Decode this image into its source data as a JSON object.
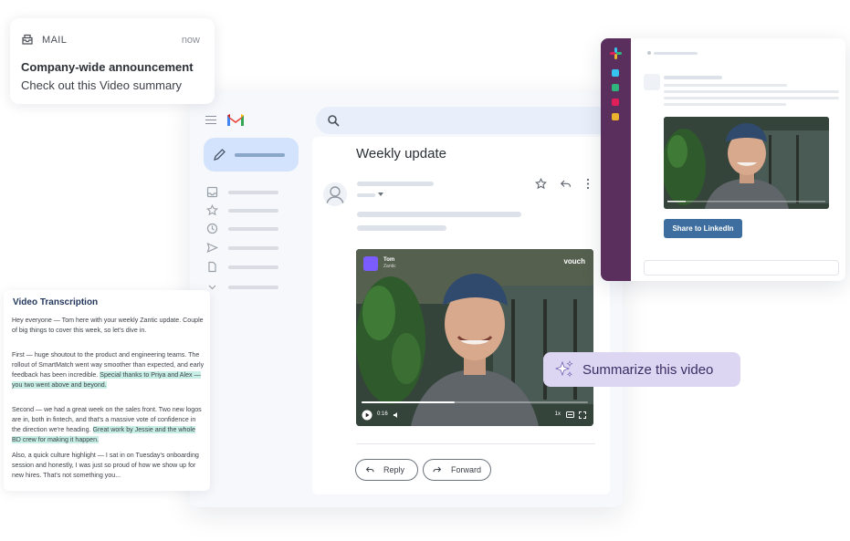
{
  "notification": {
    "app": "MAIL",
    "time": "now",
    "title": "Company-wide announcement",
    "body": "Check out this Video summary"
  },
  "gmail": {
    "subject": "Weekly update",
    "video": {
      "sender_name": "Tom",
      "sender_company": "Zantic",
      "brand": "vouch",
      "time": "0:16",
      "speed": "1x",
      "progress": 0.41
    },
    "reply_label": "Reply",
    "forward_label": "Forward"
  },
  "transcription": {
    "title": "Video Transcription",
    "p1": "Hey everyone — Tom here with your weekly Zantic update. Couple of big things to cover this week, so let's dive in.",
    "p2_plain": "First — huge shoutout to the product and engineering teams. The rollout of SmartMatch went way smoother than expected, and early feedback has been incredible.",
    "p2_highlight": "Special thanks to Priya and Alex — you two went above and beyond.",
    "p3_plain": "Second — we had a great week on the sales front. Two new logos are in, both in fintech, and that's a massive vote of confidence in the direction we're heading.",
    "p3_highlight": "Great work by Jessie and the whole BD crew for making it happen.",
    "p4": "Also, a quick culture highlight — I sat in on Tuesday's onboarding session and honestly, I was just so proud of how we show up for new hires. That's not something you..."
  },
  "summarize": {
    "label": "Summarize this video"
  },
  "slack": {
    "share_label": "Share to LinkedIn"
  },
  "colors": {
    "gmail_bg": "#f6f8fc",
    "compose": "#d3e3fd",
    "slack_sidebar": "#5a2e5d",
    "share_button": "#3e6e9f",
    "summarize_bg": "#ddd6f3",
    "highlight": "#c8efe6"
  }
}
